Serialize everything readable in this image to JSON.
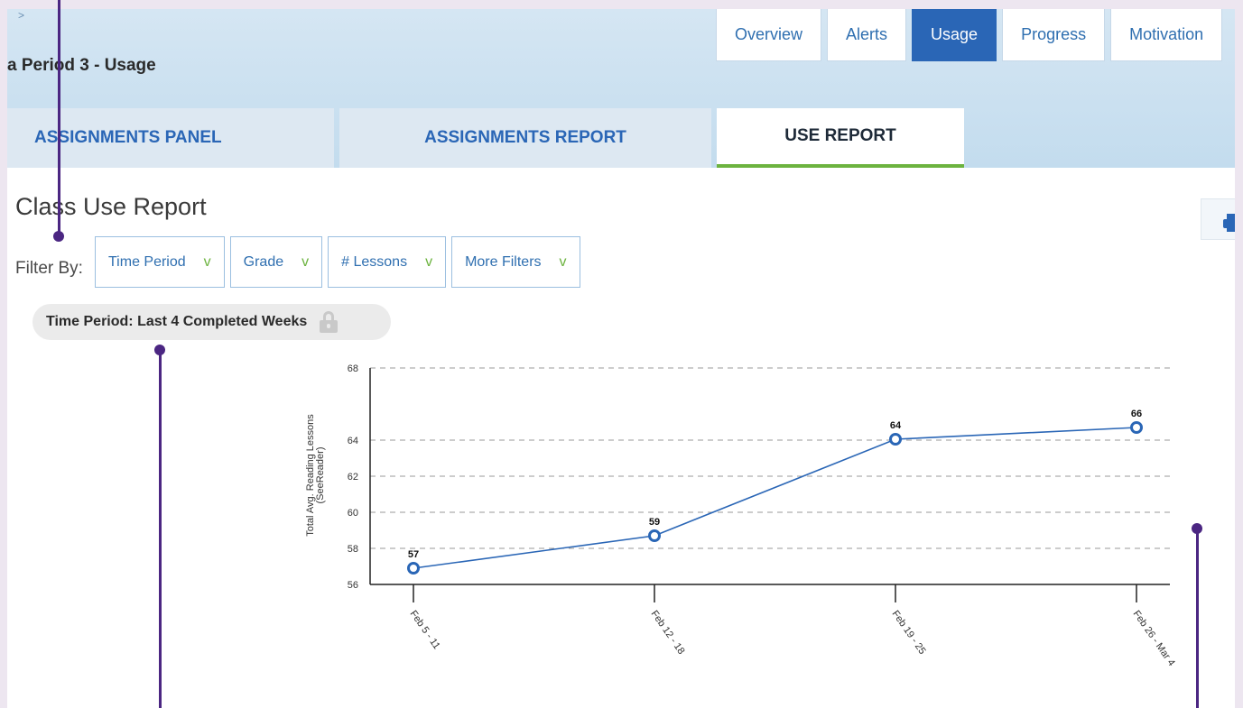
{
  "breadcrumb_separator": ">",
  "page_title": "a Period 3 - Usage",
  "top_tabs": [
    {
      "label": "Overview",
      "active": false
    },
    {
      "label": "Alerts",
      "active": false
    },
    {
      "label": "Usage",
      "active": true
    },
    {
      "label": "Progress",
      "active": false
    },
    {
      "label": "Motivation",
      "active": false
    }
  ],
  "section_tabs": [
    {
      "label": "ASSIGNMENTS PANEL",
      "active": false
    },
    {
      "label": "ASSIGNMENTS REPORT",
      "active": false
    },
    {
      "label": "USE REPORT",
      "active": true
    }
  ],
  "report": {
    "title": "Class Use Report",
    "filter_label": "Filter By:",
    "filters": [
      {
        "label": "Time Period",
        "icon": "chevron-down-icon"
      },
      {
        "label": "Grade",
        "icon": "chevron-down-icon"
      },
      {
        "label": "# Lessons",
        "icon": "chevron-down-icon"
      },
      {
        "label": "More Filters",
        "icon": "chevron-down-icon"
      }
    ],
    "chevron_glyph": "v",
    "active_filter": "Time Period: Last 4 Completed Weeks",
    "print_icon": "printer-icon",
    "lock_icon": "lock-icon"
  },
  "colors": {
    "accent_blue": "#2a66b6",
    "accent_green": "#6cb33f",
    "annotation_purple": "#4b2682"
  },
  "chart_data": {
    "type": "line",
    "categories": [
      "Feb 5 - 11",
      "Feb 12 - 18",
      "Feb 19 - 25",
      "Feb 26 - Mar 4"
    ],
    "series": [
      {
        "values": [
          56.9,
          58.7,
          64.05,
          64.7
        ]
      }
    ],
    "data_labels": [
      "57",
      "59",
      "64",
      "66"
    ],
    "ylabel_lines": [
      "Total Avg. Reading Lessons",
      "(SeeReader)"
    ],
    "ylim": [
      56,
      68
    ],
    "yticks": [
      56,
      58,
      60,
      62,
      64,
      68
    ],
    "grid": true,
    "line_color": "#2a66b6"
  }
}
